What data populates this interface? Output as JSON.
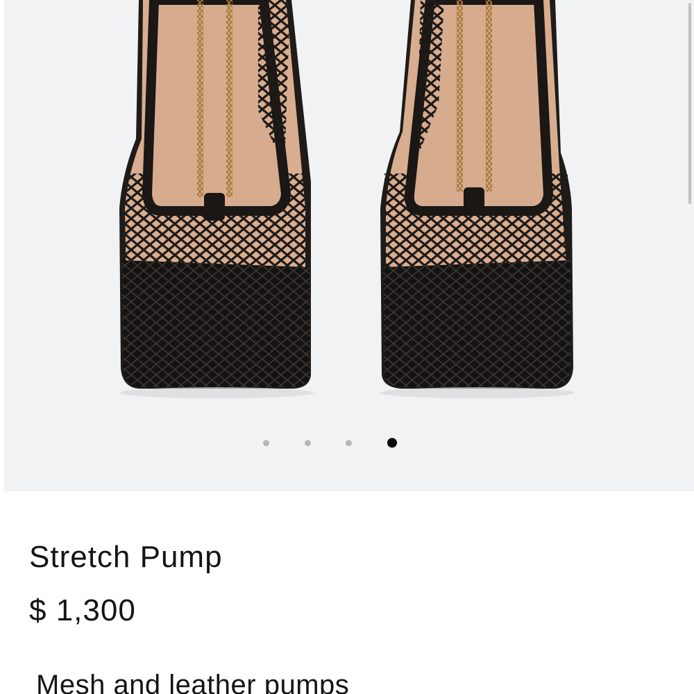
{
  "product": {
    "title": "Stretch Pump",
    "price": "$ 1,300",
    "description": "Mesh and leather pumps"
  },
  "gallery": {
    "image_alt": "Black mesh and leather square-toe pumps with gold chain detail, top view",
    "slide_count": 4,
    "active_slide": 4,
    "slides": [
      "slide 1",
      "slide 2",
      "slide 3",
      "slide 4"
    ]
  },
  "colors": {
    "background": "#f1f2f3",
    "text": "#141414",
    "dot_active": "#0b0b0b",
    "dot_inactive": "#b6b7b9"
  }
}
